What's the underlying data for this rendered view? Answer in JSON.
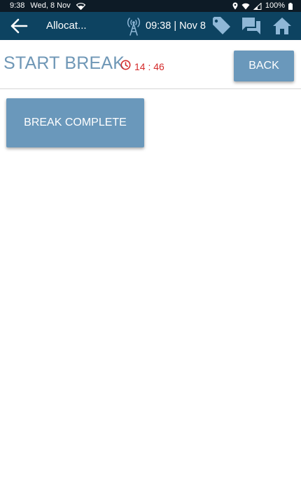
{
  "status_bar": {
    "time": "9:38",
    "date": "Wed, 8 Nov",
    "battery": "100%",
    "icons": [
      "wifi-icon",
      "location-icon",
      "signal-icon",
      "battery-icon"
    ]
  },
  "app_bar": {
    "title": "Allocat...",
    "clock": "09:38 | Nov 8",
    "icons": [
      "back-arrow-icon",
      "radio-tower-icon",
      "tag-icon",
      "chat-icon",
      "home-icon"
    ]
  },
  "header": {
    "title": "START BREAK",
    "timer": "14 : 46",
    "back_label": "BACK"
  },
  "main": {
    "break_complete_label": "BREAK COMPLETE"
  },
  "colors": {
    "status_bar_bg": "#0d1b26",
    "app_bar_bg": "#0d4361",
    "title_text": "#6f97b6",
    "button_bg": "#6a98bb",
    "timer_red": "#d42b2b",
    "icon_light_blue": "#8fb7d6"
  }
}
